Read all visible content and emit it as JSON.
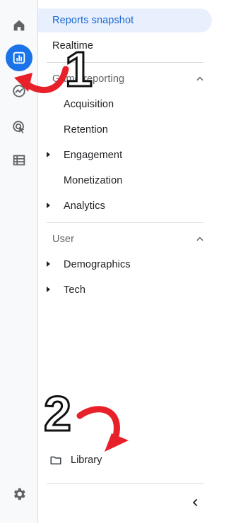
{
  "rail": {
    "items": [
      {
        "icon": "home-icon"
      },
      {
        "icon": "reports-icon",
        "active": true
      },
      {
        "icon": "explore-icon"
      },
      {
        "icon": "advertising-icon"
      },
      {
        "icon": "configure-icon"
      }
    ],
    "settings_icon": "gear-icon"
  },
  "nav": {
    "reports_snapshot": "Reports snapshot",
    "realtime": "Realtime",
    "game_reporting": {
      "label": "Game reporting",
      "items": [
        "Acquisition",
        "Retention",
        "Engagement",
        "Monetization",
        "Analytics"
      ]
    },
    "user": {
      "label": "User",
      "items": [
        "Demographics",
        "Tech"
      ]
    },
    "library": "Library"
  },
  "annotations": {
    "marker_1": "1",
    "marker_2": "2",
    "arrow_color": "#e8202a"
  },
  "colors": {
    "accent": "#1a73e8",
    "selected_bg": "#e8f0fe",
    "selected_text": "#1967d2"
  }
}
